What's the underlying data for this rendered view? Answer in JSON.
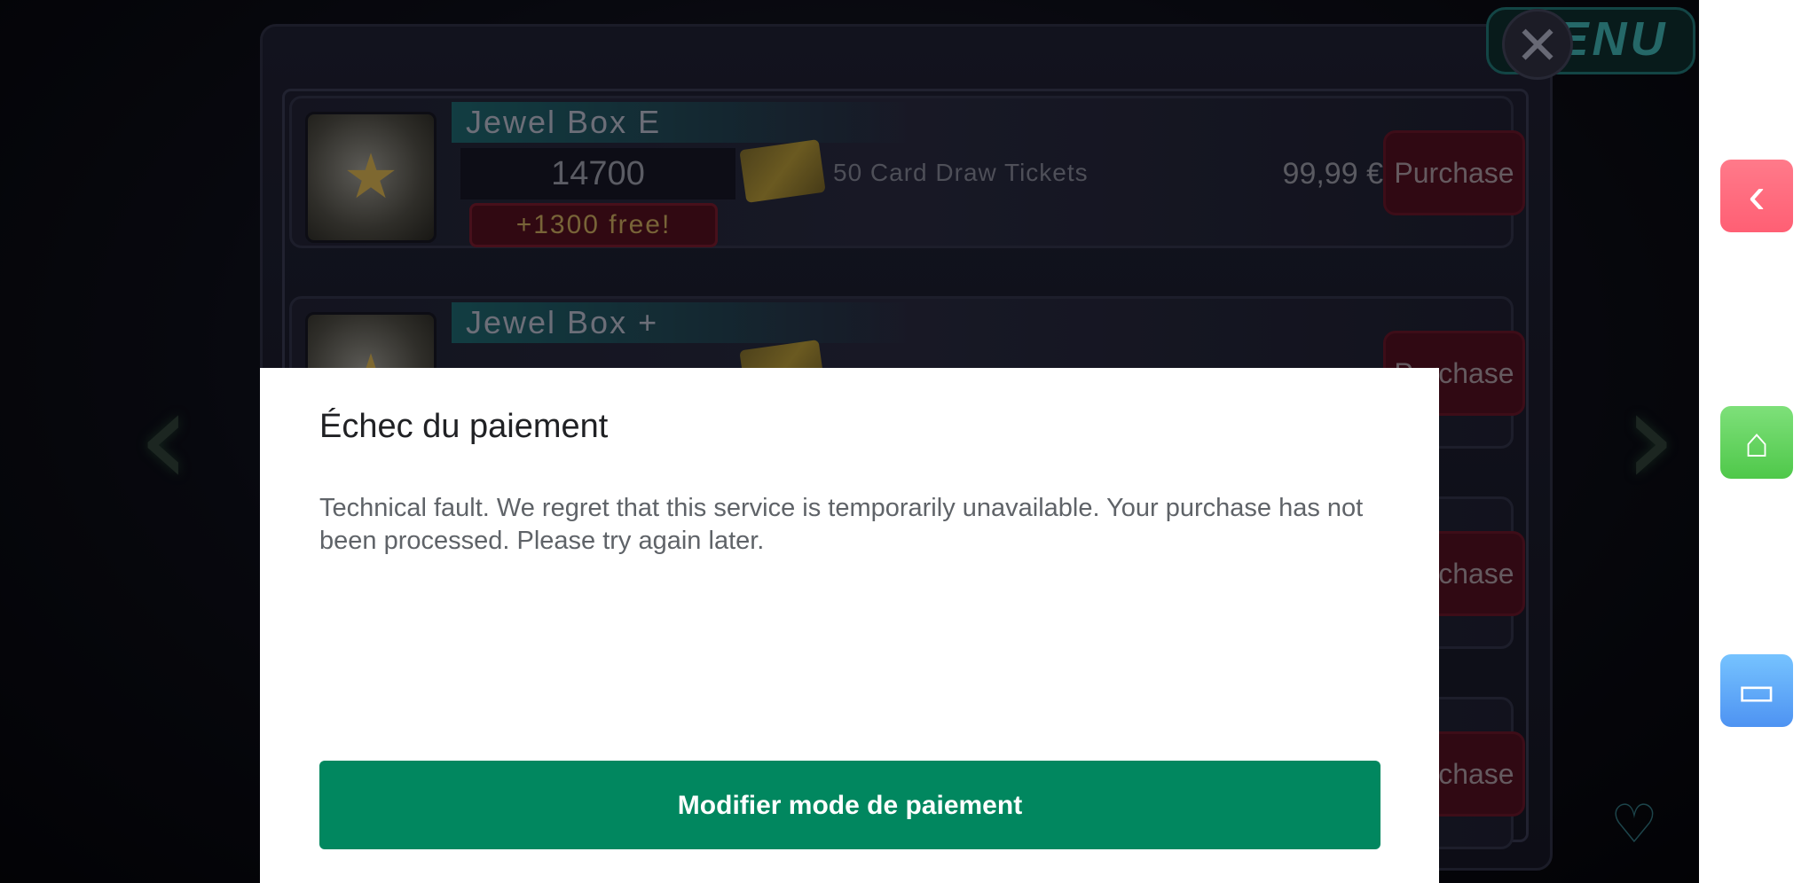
{
  "game": {
    "menu_label": "MENU",
    "products": [
      {
        "name": "Jewel Box E",
        "amount": "14700",
        "tickets": "50 Card Draw Tickets",
        "price": "99,99 €",
        "buy_label": "Purchase",
        "bonus": "+1300  free!"
      },
      {
        "name": "Jewel Box +",
        "amount": "",
        "tickets": "",
        "price": "",
        "buy_label": "Purchase",
        "bonus": ""
      },
      {
        "buy_label": "Purchase"
      },
      {
        "buy_label": "Purchase"
      }
    ]
  },
  "dialog": {
    "title": "Échec du paiement",
    "message": "Technical fault. We regret that this service is temporarily unavailable. Your purchase has not been processed. Please try again later.",
    "button_label": "Modifier mode de paiement"
  },
  "system_bar": {
    "icons": [
      "back-icon",
      "home-icon",
      "recents-icon"
    ],
    "colors": {
      "back": "#ff6a7d",
      "home": "#5fd45a",
      "recents": "#5aa2f6"
    }
  },
  "colors": {
    "accent": "#01875f"
  }
}
